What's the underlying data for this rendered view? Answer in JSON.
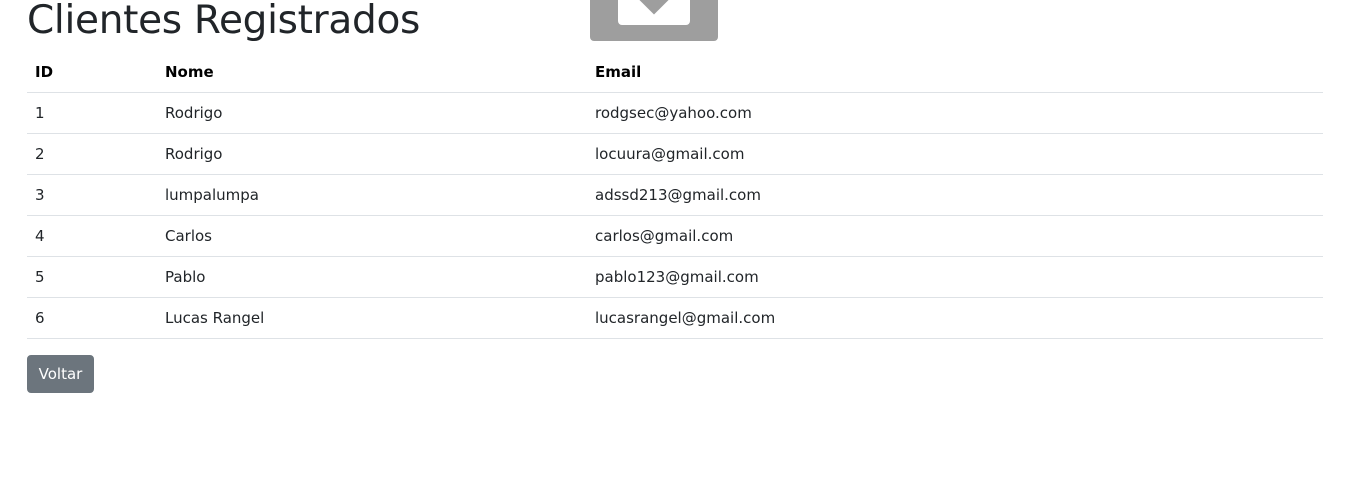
{
  "page": {
    "title": "Clientes Registrados"
  },
  "table": {
    "headers": [
      "ID",
      "Nome",
      "Email"
    ],
    "rows": [
      {
        "id": "1",
        "nome": "Rodrigo",
        "email": "rodgsec@yahoo.com"
      },
      {
        "id": "2",
        "nome": "Rodrigo",
        "email": "locuura@gmail.com"
      },
      {
        "id": "3",
        "nome": "lumpalumpa",
        "email": "adssd213@gmail.com"
      },
      {
        "id": "4",
        "nome": "Carlos",
        "email": "carlos@gmail.com"
      },
      {
        "id": "5",
        "nome": "Pablo",
        "email": "pablo123@gmail.com"
      },
      {
        "id": "6",
        "nome": "Lucas Rangel",
        "email": "lucasrangel@gmail.com"
      }
    ]
  },
  "actions": {
    "back_label": "Voltar"
  },
  "colors": {
    "text": "#212529",
    "button": "#6c757d",
    "border": "#dee2e6",
    "broken_image": "#9e9e9e"
  },
  "icons": {
    "broken_image": "broken-image-icon"
  }
}
